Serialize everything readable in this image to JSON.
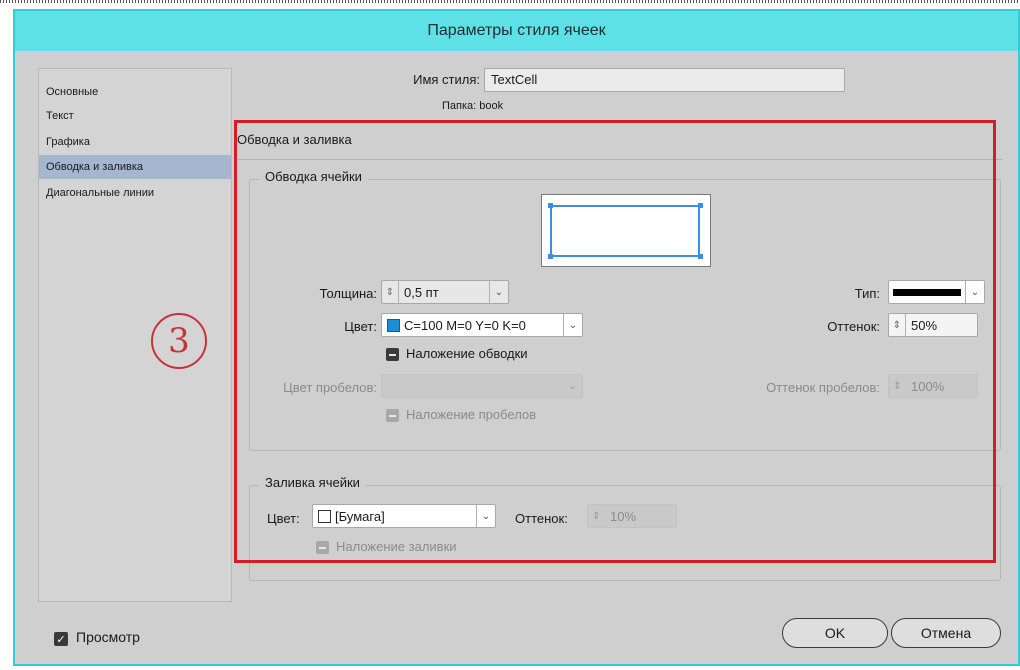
{
  "dialog": {
    "title": "Параметры стиля ячеек"
  },
  "sidebar": {
    "items": [
      {
        "label": "Основные"
      },
      {
        "label": "Текст"
      },
      {
        "label": "Графика"
      },
      {
        "label": "Обводка и заливка",
        "active": true
      },
      {
        "label": "Диагональные линии"
      }
    ]
  },
  "style_name": {
    "label": "Имя стиля:",
    "value": "TextCell",
    "folder_label": "Папка: book"
  },
  "panel": {
    "title": "Обводка и заливка"
  },
  "stroke": {
    "group_title": "Обводка ячейки",
    "weight_label": "Толщина:",
    "weight_value": "0,5 пт",
    "type_label": "Тип:",
    "color_label": "Цвет:",
    "color_value": "C=100 M=0 Y=0 K=0",
    "color_swatch": "#1a8fd8",
    "tint_label": "Оттенок:",
    "tint_value": "50%",
    "overprint_label": "Наложение обводки",
    "gap_color_label": "Цвет пробелов:",
    "gap_color_value": "",
    "gap_tint_label": "Оттенок пробелов:",
    "gap_tint_value": "100%",
    "gap_overprint_label": "Наложение пробелов"
  },
  "fill": {
    "group_title": "Заливка ячейки",
    "color_label": "Цвет:",
    "color_value": "[Бумага]",
    "color_swatch": "#ffffff",
    "tint_label": "Оттенок:",
    "tint_value": "10%",
    "overprint_label": "Наложение заливки"
  },
  "annotation": {
    "number": "3"
  },
  "footer": {
    "preview_label": "Просмотр",
    "ok_label": "OK",
    "cancel_label": "Отмена"
  },
  "colors": {
    "titlebar": "#5de1e6",
    "dialog_bg": "#cfcfcf",
    "highlight": "#d21f27",
    "selected_item": "#a4b6d0"
  }
}
